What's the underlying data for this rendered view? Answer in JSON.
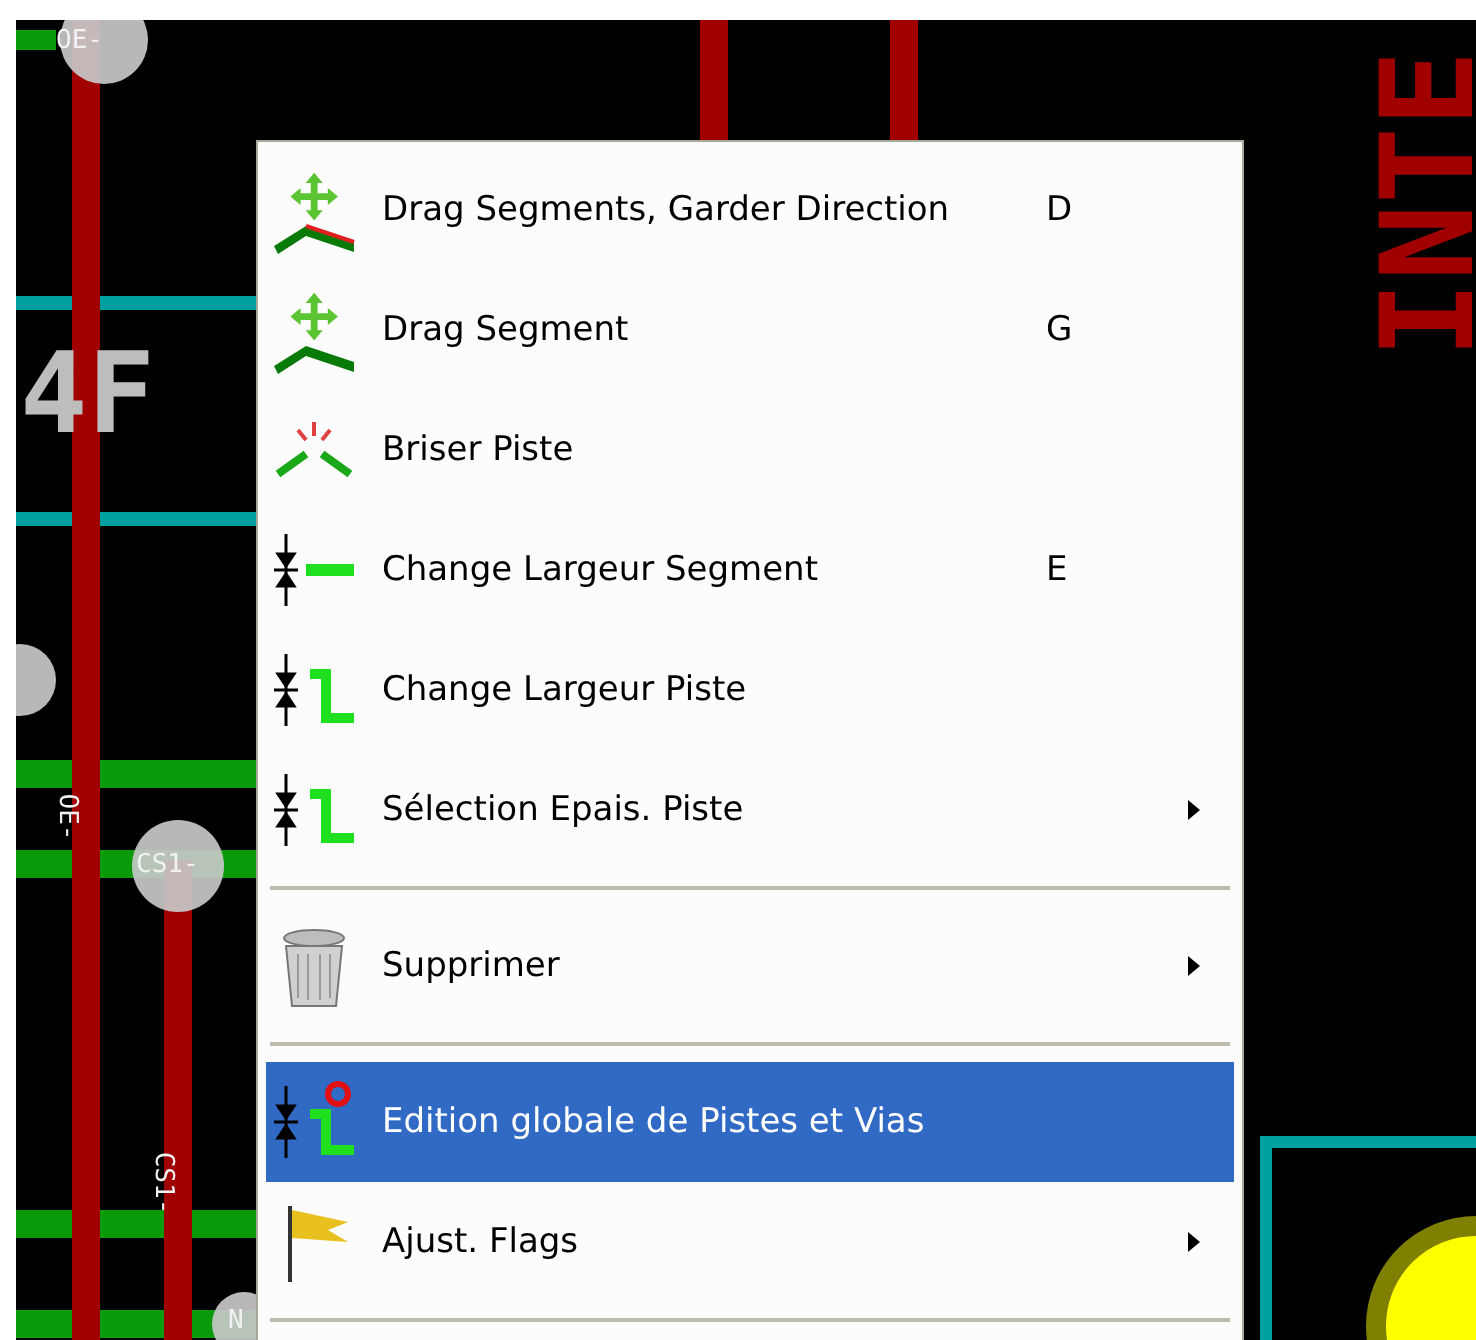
{
  "pcb_labels": [
    {
      "text": "OE-",
      "kind": "pad"
    },
    {
      "text": "4F",
      "kind": "silk"
    },
    {
      "text": "OE-",
      "kind": "track-vertical"
    },
    {
      "text": "CS1-",
      "kind": "pad"
    },
    {
      "text": "CS1-",
      "kind": "track-vertical"
    },
    {
      "text": "N",
      "kind": "pad"
    },
    {
      "text": "INTE",
      "kind": "title-vertical"
    }
  ],
  "menu": {
    "items": [
      {
        "kind": "drag-keep",
        "label": "Drag Segments, Garder Direction",
        "shortcut": "D",
        "submenu": false,
        "selected": false
      },
      {
        "kind": "drag",
        "label": "Drag Segment",
        "shortcut": "G",
        "submenu": false,
        "selected": false
      },
      {
        "kind": "break",
        "label": "Briser Piste",
        "submenu": false,
        "selected": false
      },
      {
        "kind": "width-segment",
        "label": "Change Largeur Segment",
        "shortcut": "E",
        "submenu": false,
        "selected": false
      },
      {
        "kind": "width-track",
        "label": "Change Largeur Piste",
        "submenu": false,
        "selected": false
      },
      {
        "kind": "width-track",
        "label": "Sélection Epais. Piste",
        "submenu": true,
        "selected": false
      },
      {
        "kind": "separator"
      },
      {
        "kind": "delete",
        "label": "Supprimer",
        "submenu": true,
        "selected": false
      },
      {
        "kind": "separator"
      },
      {
        "kind": "global-edit",
        "label": "Edition globale de Pistes et Vias",
        "submenu": false,
        "selected": true
      },
      {
        "kind": "flag",
        "label": "Ajust. Flags",
        "submenu": true,
        "selected": false
      },
      {
        "kind": "separator"
      }
    ]
  }
}
